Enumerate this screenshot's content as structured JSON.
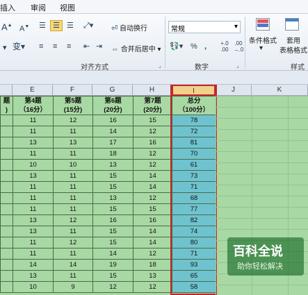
{
  "tabs": [
    "插入",
    "审阅",
    "视图"
  ],
  "ribbon": {
    "font_grow": "A",
    "font_shrink": "A",
    "pinyin": "变",
    "wrap_text": "自动换行",
    "merge_center": "合并后居中",
    "group_align": "对齐方式",
    "number_format": "常规",
    "percent": "%",
    "comma": ",",
    "dec_inc": "+.0 .00",
    "dec_dec": ".00 →.0",
    "group_number": "数字",
    "cond_format": "条件格式",
    "table_format_1": "套用",
    "table_format_2": "表格格式",
    "group_styles": "样式"
  },
  "columns": [
    "",
    "E",
    "F",
    "G",
    "H",
    "I",
    "J",
    "K"
  ],
  "header_row": {
    "d_line1": "题",
    "d_line2": ")",
    "e_line1": "第4题",
    "e_line2": "（16分）",
    "f_line1": "第5题",
    "f_line2": "(15分)",
    "g_line1": "第6题",
    "g_line2": "(20分)",
    "h_line1": "第7题",
    "h_line2": "(20分)",
    "i_line1": "总分",
    "i_line2": "（100分）"
  },
  "rows": [
    [
      "11",
      "12",
      "16",
      "15",
      "78"
    ],
    [
      "11",
      "11",
      "14",
      "12",
      "72"
    ],
    [
      "13",
      "13",
      "17",
      "16",
      "81"
    ],
    [
      "11",
      "11",
      "18",
      "12",
      "70"
    ],
    [
      "10",
      "10",
      "13",
      "12",
      "61"
    ],
    [
      "13",
      "11",
      "15",
      "14",
      "73"
    ],
    [
      "11",
      "11",
      "15",
      "14",
      "71"
    ],
    [
      "11",
      "11",
      "13",
      "12",
      "68"
    ],
    [
      "11",
      "11",
      "15",
      "15",
      "77"
    ],
    [
      "13",
      "12",
      "16",
      "16",
      "82"
    ],
    [
      "13",
      "11",
      "15",
      "14",
      "74"
    ],
    [
      "11",
      "12",
      "15",
      "14",
      "80"
    ],
    [
      "11",
      "11",
      "14",
      "12",
      "71"
    ],
    [
      "14",
      "14",
      "19",
      "18",
      "93"
    ],
    [
      "13",
      "11",
      "15",
      "13",
      "65"
    ],
    [
      "10",
      "9",
      "12",
      "12",
      "58"
    ]
  ],
  "watermark": {
    "title": "百科全说",
    "subtitle": "助你轻松解决"
  },
  "colors": {
    "grid_bg": "#a8d8a3",
    "score_bg": "#6fc3cf",
    "selection": "#c2262e"
  }
}
